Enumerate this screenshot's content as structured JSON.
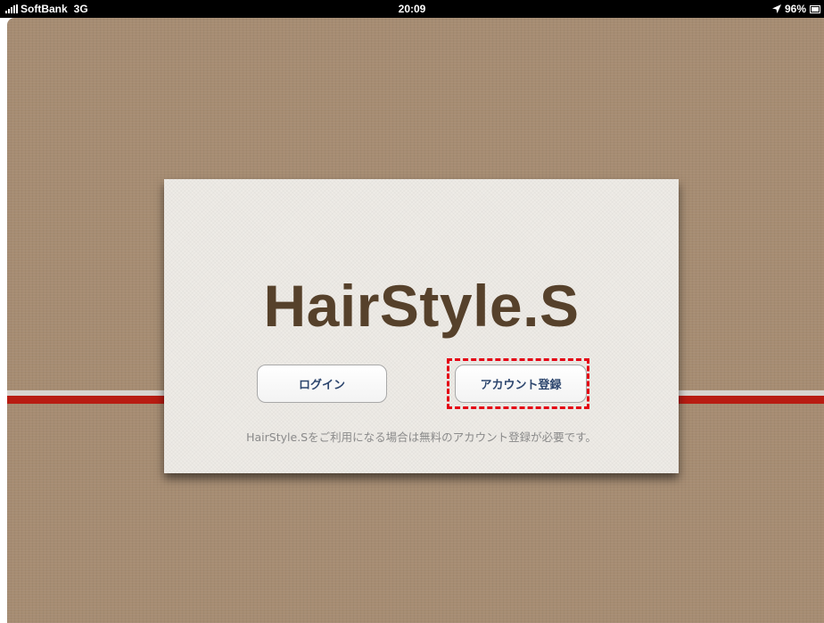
{
  "status_bar": {
    "carrier": "SoftBank",
    "network": "3G",
    "time": "20:09",
    "battery": "96%",
    "location_icon": "location-arrow-icon",
    "battery_icon": "battery-icon"
  },
  "card": {
    "logo": "HairStyle.S",
    "login_button": "ログイン",
    "register_button": "アカウント登録",
    "note": "HairStyle.Sをご利用になる場合は無料のアカウント登録が必要です。"
  },
  "colors": {
    "background": "#a68c72",
    "stripe_red": "#b81c12",
    "logo": "#56412b",
    "button_text": "#2d466e",
    "highlight": "#e40014"
  }
}
